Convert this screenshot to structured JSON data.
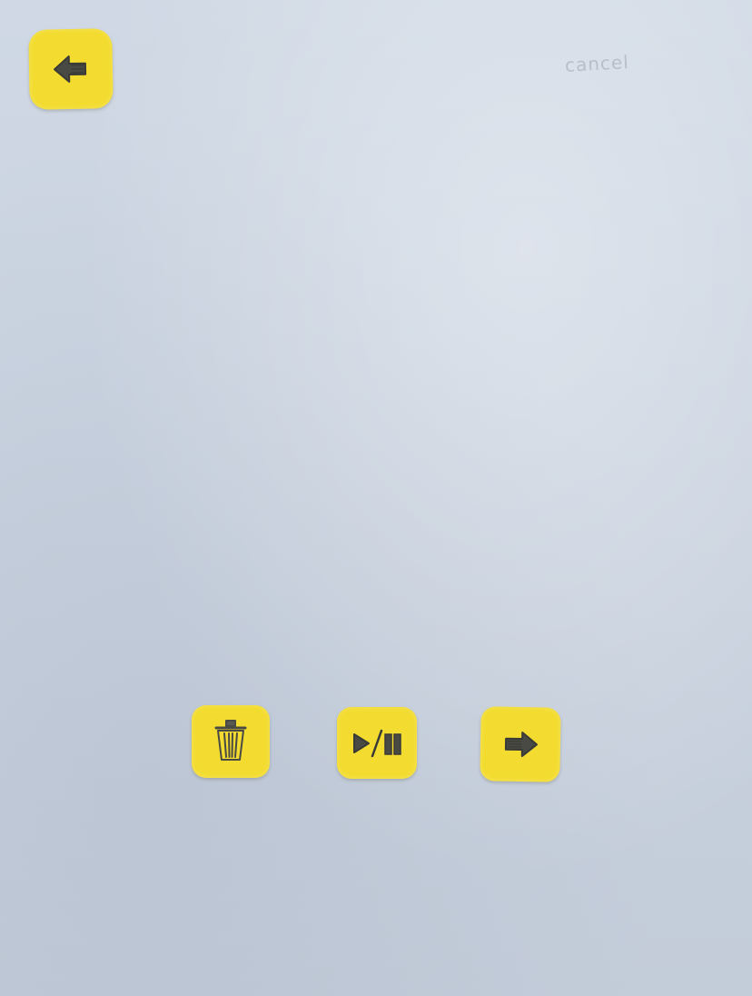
{
  "screen": {
    "background_color": "#cdd6e3",
    "accent_color": "#f3dc2f",
    "pencil_note": "cancel"
  },
  "controls": {
    "back": {
      "icon": "arrow-left-icon"
    },
    "delete": {
      "icon": "trash-icon"
    },
    "play_pause": {
      "icon": "play-pause-icon"
    },
    "next": {
      "icon": "arrow-right-icon"
    }
  }
}
